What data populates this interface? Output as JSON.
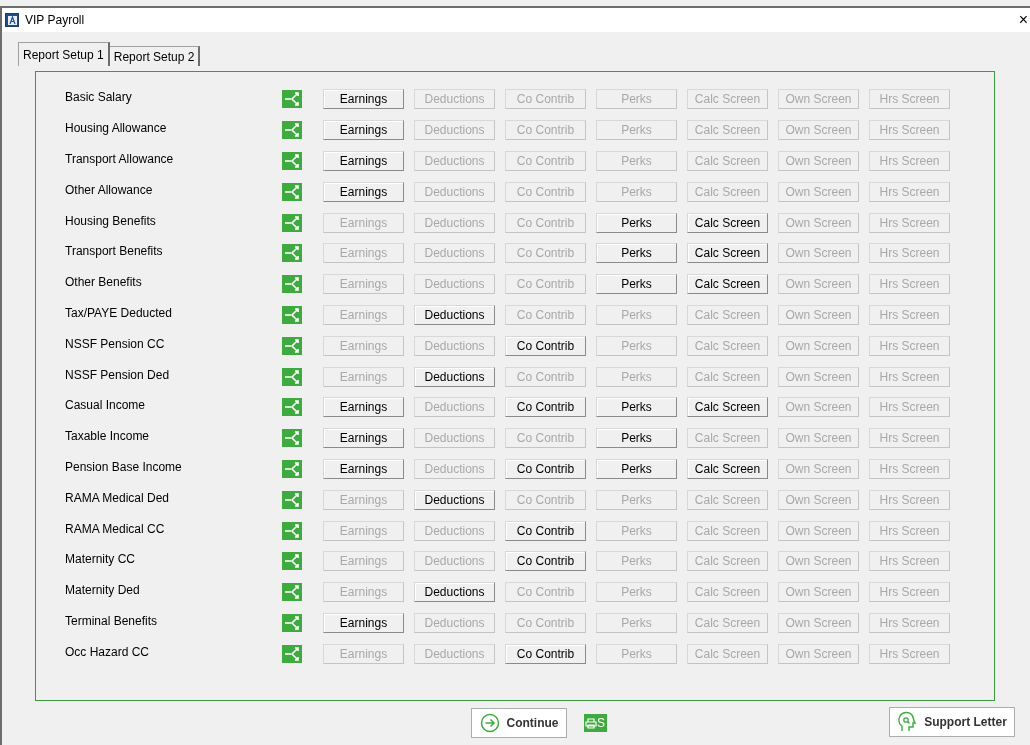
{
  "window": {
    "title": "VIP Payroll",
    "close": "×"
  },
  "tabs": [
    {
      "label": "Report Setup 1",
      "selected": true
    },
    {
      "label": "Report Setup 2",
      "selected": false
    }
  ],
  "rows": [
    {
      "label": "Basic Salary",
      "buttons": [
        {
          "label": "Earnings",
          "enabled": true
        },
        {
          "label": "Deductions",
          "enabled": false
        },
        {
          "label": "Co Contrib",
          "enabled": false
        },
        {
          "label": "Perks",
          "enabled": false
        },
        {
          "label": "Calc Screen",
          "enabled": false
        },
        {
          "label": "Own Screen",
          "enabled": false
        },
        {
          "label": "Hrs Screen",
          "enabled": false
        }
      ]
    },
    {
      "label": "Housing Allowance",
      "buttons": [
        {
          "label": "Earnings",
          "enabled": true
        },
        {
          "label": "Deductions",
          "enabled": false
        },
        {
          "label": "Co Contrib",
          "enabled": false
        },
        {
          "label": "Perks",
          "enabled": false
        },
        {
          "label": "Calc Screen",
          "enabled": false
        },
        {
          "label": "Own Screen",
          "enabled": false
        },
        {
          "label": "Hrs Screen",
          "enabled": false
        }
      ]
    },
    {
      "label": "Transport Allowance",
      "buttons": [
        {
          "label": "Earnings",
          "enabled": true
        },
        {
          "label": "Deductions",
          "enabled": false
        },
        {
          "label": "Co Contrib",
          "enabled": false
        },
        {
          "label": "Perks",
          "enabled": false
        },
        {
          "label": "Calc Screen",
          "enabled": false
        },
        {
          "label": "Own Screen",
          "enabled": false
        },
        {
          "label": "Hrs Screen",
          "enabled": false
        }
      ]
    },
    {
      "label": "Other Allowance",
      "buttons": [
        {
          "label": "Earnings",
          "enabled": true
        },
        {
          "label": "Deductions",
          "enabled": false
        },
        {
          "label": "Co Contrib",
          "enabled": false
        },
        {
          "label": "Perks",
          "enabled": false
        },
        {
          "label": "Calc Screen",
          "enabled": false
        },
        {
          "label": "Own Screen",
          "enabled": false
        },
        {
          "label": "Hrs Screen",
          "enabled": false
        }
      ]
    },
    {
      "label": "Housing Benefits",
      "buttons": [
        {
          "label": "Earnings",
          "enabled": false
        },
        {
          "label": "Deductions",
          "enabled": false
        },
        {
          "label": "Co Contrib",
          "enabled": false
        },
        {
          "label": "Perks",
          "enabled": true
        },
        {
          "label": "Calc Screen",
          "enabled": true
        },
        {
          "label": "Own Screen",
          "enabled": false
        },
        {
          "label": "Hrs Screen",
          "enabled": false
        }
      ]
    },
    {
      "label": "Transport Benefits",
      "buttons": [
        {
          "label": "Earnings",
          "enabled": false
        },
        {
          "label": "Deductions",
          "enabled": false
        },
        {
          "label": "Co Contrib",
          "enabled": false
        },
        {
          "label": "Perks",
          "enabled": true
        },
        {
          "label": "Calc Screen",
          "enabled": true
        },
        {
          "label": "Own Screen",
          "enabled": false
        },
        {
          "label": "Hrs Screen",
          "enabled": false
        }
      ]
    },
    {
      "label": "Other Benefits",
      "buttons": [
        {
          "label": "Earnings",
          "enabled": false
        },
        {
          "label": "Deductions",
          "enabled": false
        },
        {
          "label": "Co Contrib",
          "enabled": false
        },
        {
          "label": "Perks",
          "enabled": true
        },
        {
          "label": "Calc Screen",
          "enabled": true
        },
        {
          "label": "Own Screen",
          "enabled": false
        },
        {
          "label": "Hrs Screen",
          "enabled": false
        }
      ]
    },
    {
      "label": "Tax/PAYE Deducted",
      "buttons": [
        {
          "label": "Earnings",
          "enabled": false
        },
        {
          "label": "Deductions",
          "enabled": true
        },
        {
          "label": "Co Contrib",
          "enabled": false
        },
        {
          "label": "Perks",
          "enabled": false
        },
        {
          "label": "Calc Screen",
          "enabled": false
        },
        {
          "label": "Own Screen",
          "enabled": false
        },
        {
          "label": "Hrs Screen",
          "enabled": false
        }
      ]
    },
    {
      "label": "NSSF Pension CC",
      "buttons": [
        {
          "label": "Earnings",
          "enabled": false
        },
        {
          "label": "Deductions",
          "enabled": false
        },
        {
          "label": "Co Contrib",
          "enabled": true
        },
        {
          "label": "Perks",
          "enabled": false
        },
        {
          "label": "Calc Screen",
          "enabled": false
        },
        {
          "label": "Own Screen",
          "enabled": false
        },
        {
          "label": "Hrs Screen",
          "enabled": false
        }
      ]
    },
    {
      "label": "NSSF Pension Ded",
      "buttons": [
        {
          "label": "Earnings",
          "enabled": false
        },
        {
          "label": "Deductions",
          "enabled": true
        },
        {
          "label": "Co Contrib",
          "enabled": false
        },
        {
          "label": "Perks",
          "enabled": false
        },
        {
          "label": "Calc Screen",
          "enabled": false
        },
        {
          "label": "Own Screen",
          "enabled": false
        },
        {
          "label": "Hrs Screen",
          "enabled": false
        }
      ]
    },
    {
      "label": "Casual Income",
      "buttons": [
        {
          "label": "Earnings",
          "enabled": true
        },
        {
          "label": "Deductions",
          "enabled": false
        },
        {
          "label": "Co Contrib",
          "enabled": true
        },
        {
          "label": "Perks",
          "enabled": true
        },
        {
          "label": "Calc Screen",
          "enabled": true
        },
        {
          "label": "Own Screen",
          "enabled": false
        },
        {
          "label": "Hrs Screen",
          "enabled": false
        }
      ]
    },
    {
      "label": "Taxable Income",
      "buttons": [
        {
          "label": "Earnings",
          "enabled": true
        },
        {
          "label": "Deductions",
          "enabled": false
        },
        {
          "label": "Co Contrib",
          "enabled": false
        },
        {
          "label": "Perks",
          "enabled": true
        },
        {
          "label": "Calc Screen",
          "enabled": false
        },
        {
          "label": "Own Screen",
          "enabled": false
        },
        {
          "label": "Hrs Screen",
          "enabled": false
        }
      ]
    },
    {
      "label": "Pension Base Income",
      "buttons": [
        {
          "label": "Earnings",
          "enabled": true
        },
        {
          "label": "Deductions",
          "enabled": false
        },
        {
          "label": "Co Contrib",
          "enabled": true
        },
        {
          "label": "Perks",
          "enabled": true
        },
        {
          "label": "Calc Screen",
          "enabled": true
        },
        {
          "label": "Own Screen",
          "enabled": false
        },
        {
          "label": "Hrs Screen",
          "enabled": false
        }
      ]
    },
    {
      "label": "RAMA Medical Ded",
      "buttons": [
        {
          "label": "Earnings",
          "enabled": false
        },
        {
          "label": "Deductions",
          "enabled": true
        },
        {
          "label": "Co Contrib",
          "enabled": false
        },
        {
          "label": "Perks",
          "enabled": false
        },
        {
          "label": "Calc Screen",
          "enabled": false
        },
        {
          "label": "Own Screen",
          "enabled": false
        },
        {
          "label": "Hrs Screen",
          "enabled": false
        }
      ]
    },
    {
      "label": "RAMA Medical CC",
      "buttons": [
        {
          "label": "Earnings",
          "enabled": false
        },
        {
          "label": "Deductions",
          "enabled": false
        },
        {
          "label": "Co Contrib",
          "enabled": true
        },
        {
          "label": "Perks",
          "enabled": false
        },
        {
          "label": "Calc Screen",
          "enabled": false
        },
        {
          "label": "Own Screen",
          "enabled": false
        },
        {
          "label": "Hrs Screen",
          "enabled": false
        }
      ]
    },
    {
      "label": "Maternity CC",
      "buttons": [
        {
          "label": "Earnings",
          "enabled": false
        },
        {
          "label": "Deductions",
          "enabled": false
        },
        {
          "label": "Co Contrib",
          "enabled": true
        },
        {
          "label": "Perks",
          "enabled": false
        },
        {
          "label": "Calc Screen",
          "enabled": false
        },
        {
          "label": "Own Screen",
          "enabled": false
        },
        {
          "label": "Hrs Screen",
          "enabled": false
        }
      ]
    },
    {
      "label": "Maternity Ded",
      "buttons": [
        {
          "label": "Earnings",
          "enabled": false
        },
        {
          "label": "Deductions",
          "enabled": true
        },
        {
          "label": "Co Contrib",
          "enabled": false
        },
        {
          "label": "Perks",
          "enabled": false
        },
        {
          "label": "Calc Screen",
          "enabled": false
        },
        {
          "label": "Own Screen",
          "enabled": false
        },
        {
          "label": "Hrs Screen",
          "enabled": false
        }
      ]
    },
    {
      "label": "Terminal Benefits",
      "buttons": [
        {
          "label": "Earnings",
          "enabled": true
        },
        {
          "label": "Deductions",
          "enabled": false
        },
        {
          "label": "Co Contrib",
          "enabled": false
        },
        {
          "label": "Perks",
          "enabled": false
        },
        {
          "label": "Calc Screen",
          "enabled": false
        },
        {
          "label": "Own Screen",
          "enabled": false
        },
        {
          "label": "Hrs Screen",
          "enabled": false
        }
      ]
    },
    {
      "label": "Occ Hazard CC",
      "buttons": [
        {
          "label": "Earnings",
          "enabled": false
        },
        {
          "label": "Deductions",
          "enabled": false
        },
        {
          "label": "Co Contrib",
          "enabled": true
        },
        {
          "label": "Perks",
          "enabled": false
        },
        {
          "label": "Calc Screen",
          "enabled": false
        },
        {
          "label": "Own Screen",
          "enabled": false
        },
        {
          "label": "Hrs Screen",
          "enabled": false
        }
      ]
    }
  ],
  "footer": {
    "continue": "Continue",
    "print_badge": "S",
    "support": "Support Letter"
  }
}
